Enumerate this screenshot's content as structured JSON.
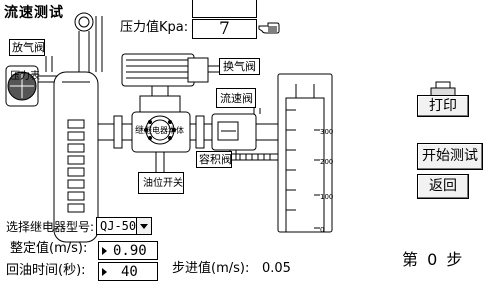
{
  "title": "流速测试",
  "pressure": {
    "label": "压力值Kpa:",
    "value": "7"
  },
  "diagram": {
    "vent_valve": "放气阀",
    "pressure_gauge": "压力表",
    "change_valve": "换气阀",
    "flow_valve": "流速阀",
    "relay": "继",
    "relay_body": "继电器本体",
    "volume_valve": "容积阀",
    "oil_switch": "油位开关"
  },
  "scale": {
    "ticks": [
      "300",
      "200",
      "100",
      "0"
    ]
  },
  "buttons": {
    "print": "打印",
    "start": "开始测试",
    "back": "返回"
  },
  "relay_select": {
    "label": "选择继电器型号:",
    "value": "QJ-50"
  },
  "setting": {
    "label": "整定值(m/s):",
    "value": "0.90"
  },
  "return_time": {
    "label": "回油时间(秒):",
    "value": "40"
  },
  "step_value": {
    "label": "步进值(m/s):",
    "value": "0.05"
  },
  "step": {
    "prefix": "第",
    "value": "0",
    "suffix": "步"
  },
  "icons": [
    "pointing-hand-icon",
    "printer-icon",
    "dropdown-arrow-icon",
    "spin-arrow-icon"
  ]
}
